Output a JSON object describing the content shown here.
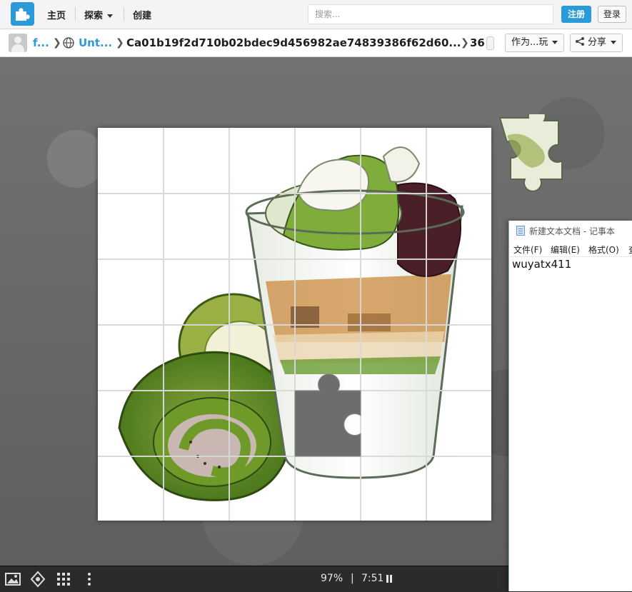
{
  "topbar": {
    "nav": {
      "home": "主页",
      "explore": "探索",
      "create": "创建"
    },
    "search": {
      "placeholder": "搜索..."
    },
    "register_label": "注册",
    "login_label": "登录"
  },
  "breadcrumb": {
    "user": "f...",
    "collection": "Unt...",
    "puzzle_name": "Ca01b19f2d710b02bdec9d456982ae74839386f62d60...",
    "piece_count": "36",
    "play_as": "作为...玩",
    "share": "分享"
  },
  "status": {
    "zoom": "97%",
    "separator": "|",
    "timer": "7:51"
  },
  "notepad": {
    "title": "新建文本文档 - 记事本",
    "menu": {
      "file": "文件(F)",
      "edit": "编辑(E)",
      "format": "格式(O)",
      "view": "查"
    },
    "content": "wuyatx411"
  },
  "colors": {
    "brand": "#2a9ad9",
    "matcha": "#6f9a2a",
    "red_bean": "#4a1f28"
  }
}
